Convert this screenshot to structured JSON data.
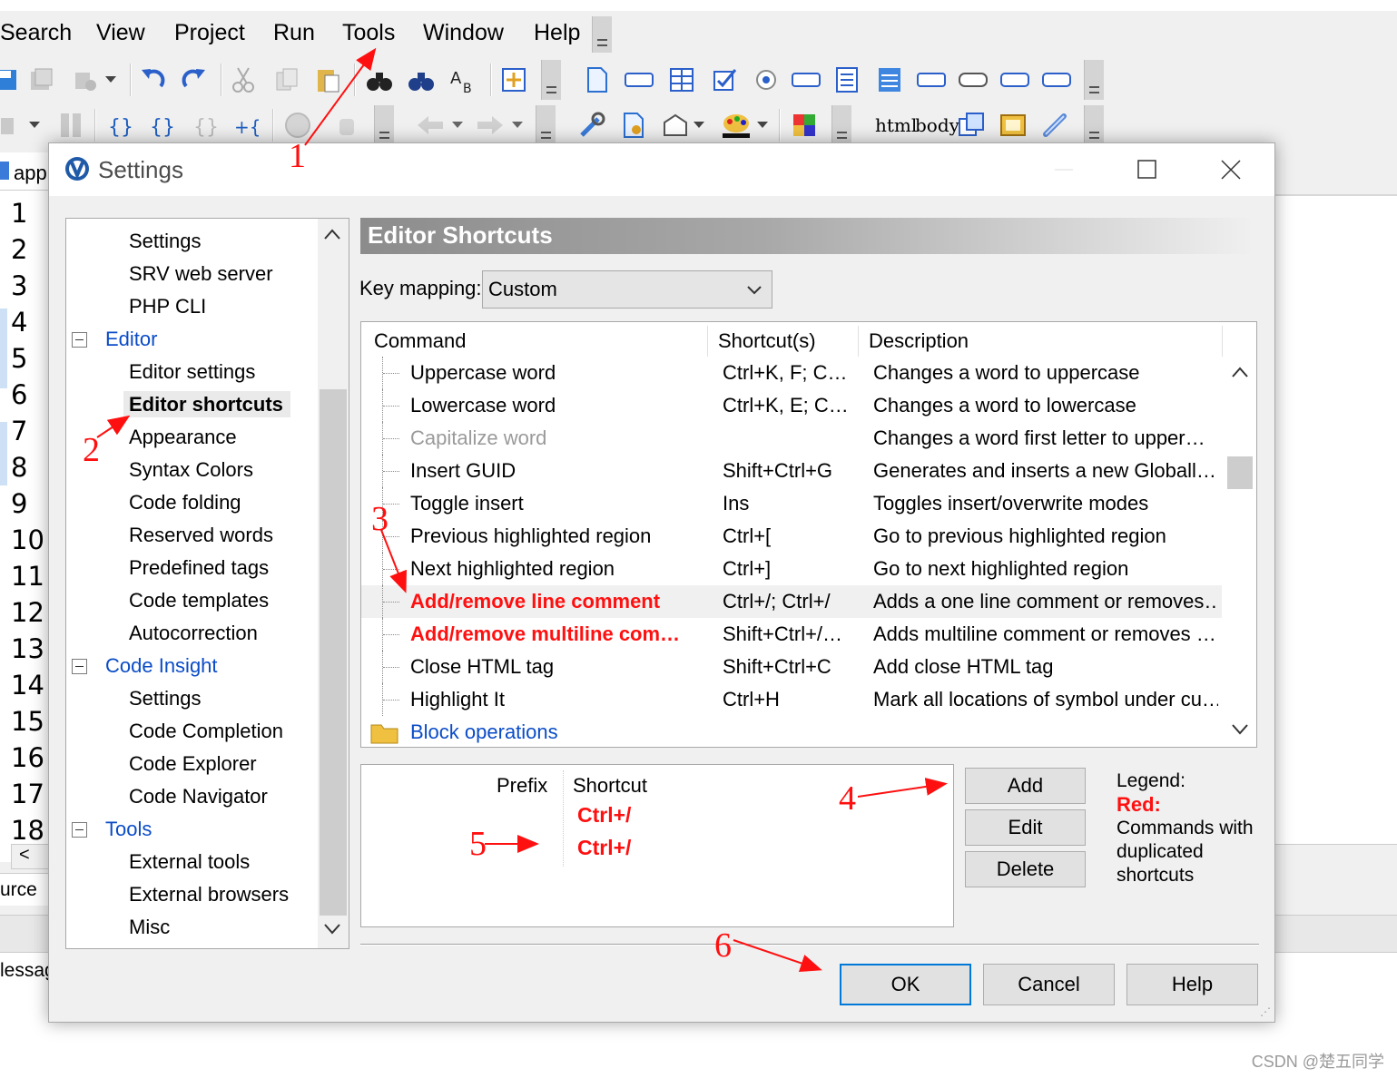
{
  "menu": {
    "items": [
      "Search",
      "View",
      "Project",
      "Run",
      "Tools",
      "Window",
      "Help"
    ]
  },
  "toolbar": {
    "html_label": "html",
    "body_label": "body"
  },
  "editor": {
    "tab_label": "app",
    "line_numbers": [
      "1",
      "2",
      "3",
      "4",
      "5",
      "6",
      "7",
      "8",
      "9",
      "10",
      "11",
      "12",
      "13",
      "14",
      "15",
      "16",
      "17",
      "18"
    ],
    "bottom_tab": "urce",
    "messages_label": "lessag"
  },
  "dialog": {
    "title": "Settings",
    "tree": [
      {
        "label": "Settings",
        "kind": "child"
      },
      {
        "label": "SRV web server",
        "kind": "child"
      },
      {
        "label": "PHP CLI",
        "kind": "child"
      },
      {
        "label": "Editor",
        "kind": "group"
      },
      {
        "label": "Editor settings",
        "kind": "child"
      },
      {
        "label": "Editor shortcuts",
        "kind": "selected"
      },
      {
        "label": "Appearance",
        "kind": "child"
      },
      {
        "label": "Syntax Colors",
        "kind": "child"
      },
      {
        "label": "Code folding",
        "kind": "child"
      },
      {
        "label": "Reserved words",
        "kind": "child"
      },
      {
        "label": "Predefined tags",
        "kind": "child"
      },
      {
        "label": "Code templates",
        "kind": "child"
      },
      {
        "label": "Autocorrection",
        "kind": "child"
      },
      {
        "label": "Code Insight",
        "kind": "group"
      },
      {
        "label": "Settings",
        "kind": "child"
      },
      {
        "label": "Code Completion",
        "kind": "child"
      },
      {
        "label": "Code Explorer",
        "kind": "child"
      },
      {
        "label": "Code Navigator",
        "kind": "child"
      },
      {
        "label": "Tools",
        "kind": "group"
      },
      {
        "label": "External tools",
        "kind": "child"
      },
      {
        "label": "External browsers",
        "kind": "child"
      },
      {
        "label": "Misc",
        "kind": "child"
      }
    ],
    "section_title": "Editor Shortcuts",
    "key_mapping": {
      "label": "Key mapping:",
      "value": "Custom"
    },
    "columns": {
      "command": "Command",
      "shortcuts": "Shortcut(s)",
      "description": "Description"
    },
    "rows": [
      {
        "command": "Uppercase word",
        "shortcut": "Ctrl+K, F; C…",
        "description": "Changes a word to uppercase",
        "state": "normal"
      },
      {
        "command": "Lowercase word",
        "shortcut": "Ctrl+K, E; C…",
        "description": "Changes a word to lowercase",
        "state": "normal"
      },
      {
        "command": "Capitalize word",
        "shortcut": "",
        "description": "Changes a word first letter to upper…",
        "state": "dim"
      },
      {
        "command": "Insert GUID",
        "shortcut": "Shift+Ctrl+G",
        "description": "Generates and inserts a new Globall…",
        "state": "normal"
      },
      {
        "command": "Toggle insert",
        "shortcut": "Ins",
        "description": "Toggles insert/overwrite modes",
        "state": "normal"
      },
      {
        "command": "Previous highlighted region",
        "shortcut": "Ctrl+[",
        "description": "Go to previous highlighted region",
        "state": "normal"
      },
      {
        "command": "Next highlighted region",
        "shortcut": "Ctrl+]",
        "description": "Go to next highlighted region",
        "state": "normal"
      },
      {
        "command": "Add/remove line comment",
        "shortcut": "Ctrl+/; Ctrl+/",
        "description": "Adds a one line comment or removes…",
        "state": "dup-selected"
      },
      {
        "command": "Add/remove multiline com…",
        "shortcut": "Shift+Ctrl+/…",
        "description": "Adds multiline comment or removes …",
        "state": "dup"
      },
      {
        "command": "Close HTML tag",
        "shortcut": "Shift+Ctrl+C",
        "description": "Add close HTML tag",
        "state": "normal"
      },
      {
        "command": "Highlight It",
        "shortcut": "Ctrl+H",
        "description": "Mark all locations of symbol under cu…",
        "state": "normal"
      },
      {
        "command": "Block operations",
        "shortcut": "",
        "description": "",
        "state": "folder"
      }
    ],
    "shortcut_box": {
      "prefix_header": "Prefix",
      "shortcut_header": "Shortcut",
      "values": [
        "Ctrl+/",
        "Ctrl+/"
      ]
    },
    "buttons": {
      "add": "Add",
      "edit": "Edit",
      "delete": "Delete",
      "ok": "OK",
      "cancel": "Cancel",
      "help": "Help"
    },
    "legend": {
      "title": "Legend:",
      "red": "Red:",
      "text": "Commands with duplicated shortcuts"
    }
  },
  "annotations": [
    "1",
    "2",
    "3",
    "4",
    "5",
    "6"
  ],
  "watermark": "CSDN @楚五同学",
  "colors": {
    "duplicate_red": "#ff1010",
    "link_blue": "#0a4cc7",
    "annotation_red": "#ff1010",
    "focus_blue": "#0078d7"
  }
}
